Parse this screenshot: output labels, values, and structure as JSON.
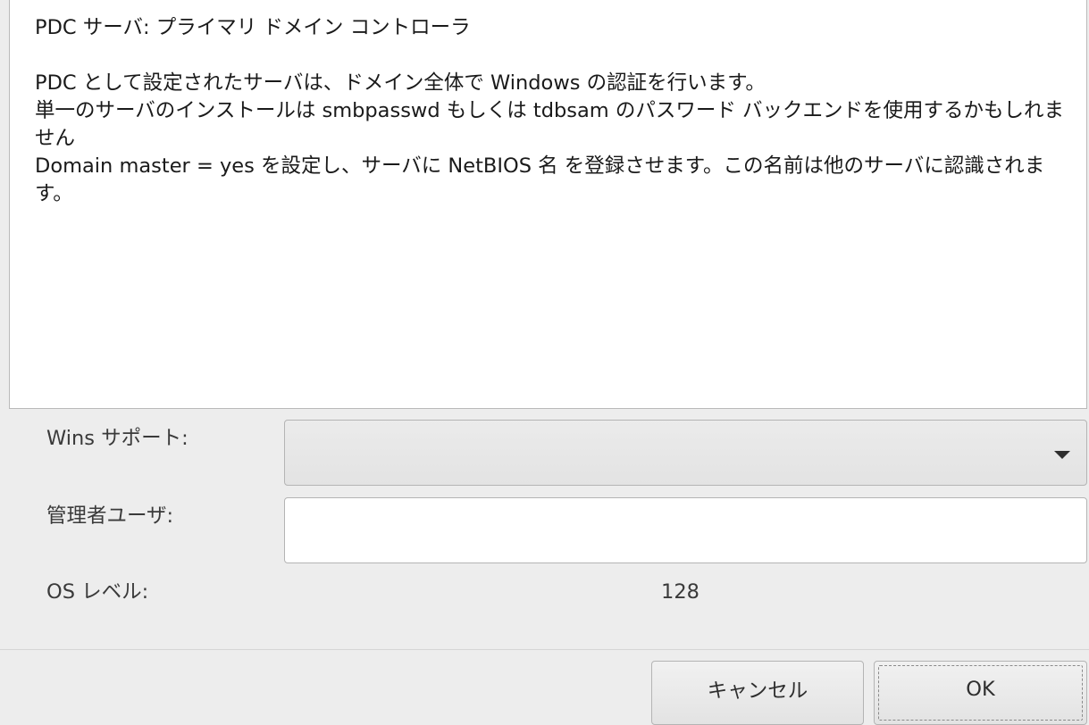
{
  "description": {
    "title": "PDC サーバ: プライマリ ドメイン コントローラ",
    "paragraphs": [
      "PDC として設定されたサーバは、ドメイン全体で Windows の認証を行います。",
      "単一のサーバのインストールは smbpasswd もしくは tdbsam のパスワード バックエンドを使用するかもしれません",
      "Domain master = yes を設定し、サーバに NetBIOS 名 を登録させます。この名前は他のサーバに認識されます。"
    ]
  },
  "form": {
    "wins_label": "Wins サポート:",
    "wins_value": "",
    "admin_label": "管理者ユーザ:",
    "admin_value": "",
    "os_level_label": "OS レベル:",
    "os_level_value": "128"
  },
  "buttons": {
    "cancel": "キャンセル",
    "ok": "OK"
  }
}
